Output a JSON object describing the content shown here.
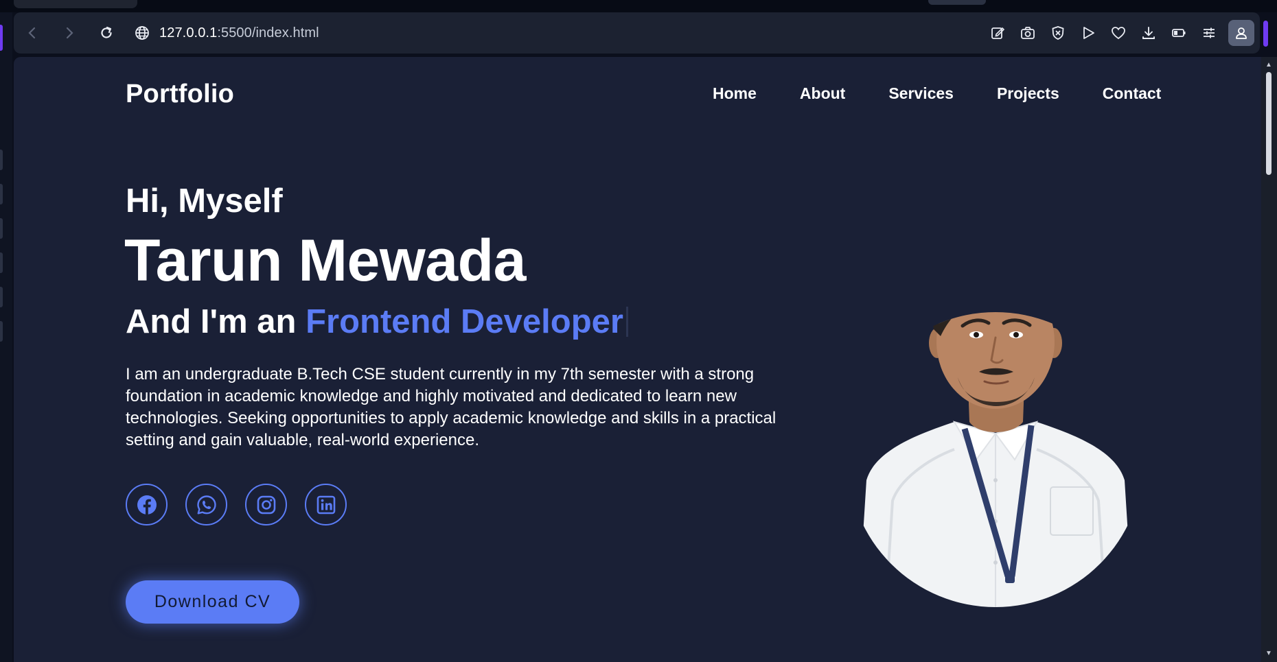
{
  "browser": {
    "url_host": "127.0.0.1",
    "url_path": ":5500/index.html",
    "toolbar_icons": [
      "edit-icon",
      "camera-icon",
      "shield-x-icon",
      "play-icon",
      "heart-icon",
      "download-icon",
      "battery-icon",
      "sliders-icon",
      "profile-icon"
    ]
  },
  "site": {
    "logo": "Portfolio",
    "nav": [
      "Home",
      "About",
      "Services",
      "Projects",
      "Contact"
    ]
  },
  "hero": {
    "greeting": "Hi, Myself",
    "name": "Tarun Mewada",
    "role_prefix": "And I'm an",
    "role_highlight": "Frontend Developer",
    "description": "I am an undergraduate B.Tech CSE student currently in my 7th semester with a strong foundation in academic knowledge and highly motivated and dedicated to learn new technologies. Seeking opportunities to apply academic knowledge and skills in a practical setting and gain valuable, real-world experience.",
    "socials": [
      "facebook-icon",
      "whatsapp-icon",
      "instagram-icon",
      "linkedin-icon"
    ],
    "cv_button": "Download CV"
  },
  "colors": {
    "page_bg": "#1a2036",
    "accent": "#5b7cf5",
    "toolbar_bg": "#1c2231",
    "browser_accent": "#6f3bf2"
  }
}
